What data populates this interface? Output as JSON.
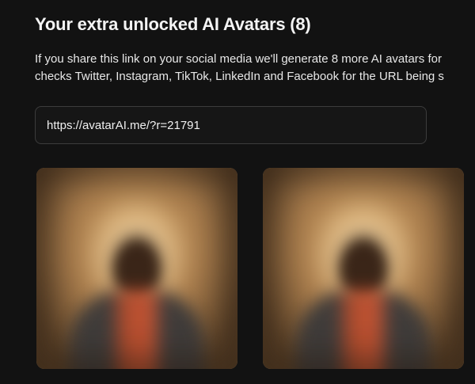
{
  "header": {
    "title": "Your extra unlocked AI Avatars (8)"
  },
  "description": {
    "line1": "If you share this link on your social media we'll generate 8 more AI avatars for",
    "line2": "checks Twitter, Instagram, TikTok, LinkedIn and Facebook for the URL being s"
  },
  "share_link": {
    "value": "https://avatarAI.me/?r=21791"
  },
  "avatars": [
    {
      "icon": "blurred-portrait"
    },
    {
      "icon": "blurred-portrait"
    }
  ],
  "colors": {
    "background": "#121212",
    "field_border": "#3c3c3c",
    "text": "#f2f2f2"
  }
}
